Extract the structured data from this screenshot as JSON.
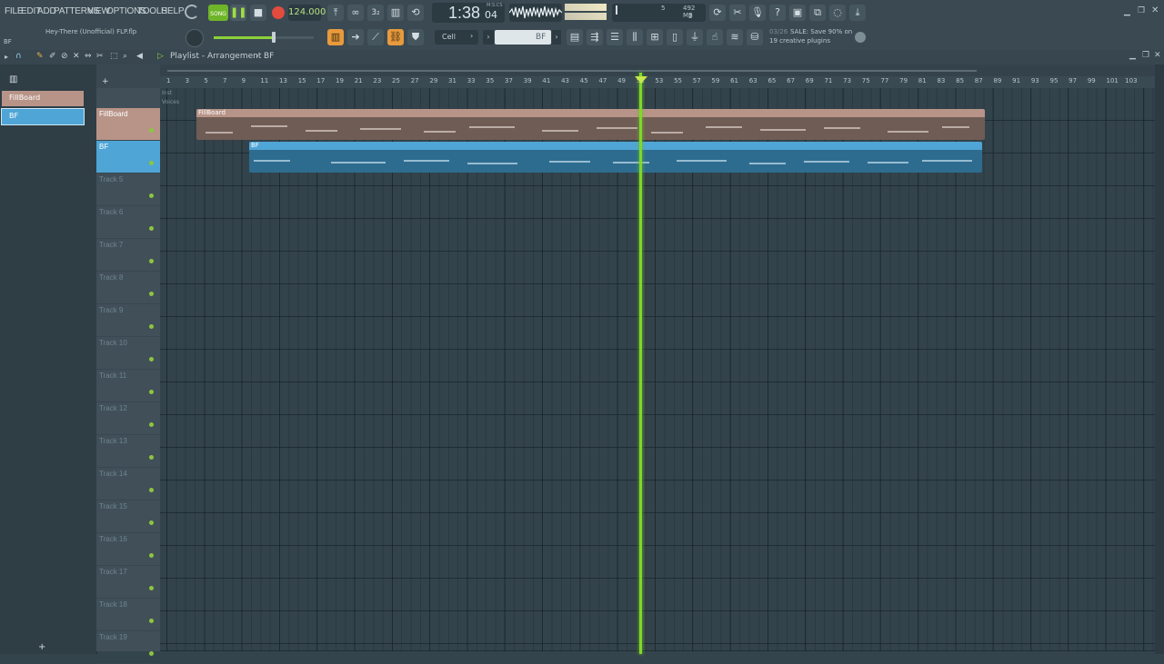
{
  "menu": [
    "FILE",
    "EDIT",
    "ADD",
    "PATTERNS",
    "VIEW",
    "OPTIONS",
    "TOOLS",
    "HELP"
  ],
  "transport": {
    "song_label": "SONG",
    "tempo": "124.000",
    "time": "1:38",
    "time_sub": "04",
    "time_unit": "M:S:CS",
    "memory": "492 MB",
    "cpu_voices": "5",
    "cpu_second": "2"
  },
  "project": {
    "title": "Hey-There (Unofficial) FLP.flp",
    "pattern_hint": "BF"
  },
  "snap": {
    "value": "Cell"
  },
  "pattern_selector": {
    "value": "BF"
  },
  "news": {
    "date": "03/26",
    "line1": "SALE: Save 90% on",
    "line2": "19 creative plugins"
  },
  "playlist": {
    "title": "Playlist - Arrangement",
    "breadcrumb": "BF"
  },
  "pattern_list": [
    {
      "name": "FillBoard",
      "color": "#b89488"
    },
    {
      "name": "BF",
      "color": "#4fa5d6"
    }
  ],
  "ruler_ticks": [
    "1",
    "3",
    "5",
    "7",
    "9",
    "11",
    "13",
    "15",
    "17",
    "19",
    "21",
    "23",
    "25",
    "27",
    "29",
    "31",
    "33",
    "35",
    "37",
    "39",
    "41",
    "43",
    "45",
    "47",
    "49",
    "51",
    "53",
    "55",
    "57",
    "59",
    "61",
    "63",
    "65",
    "67",
    "69",
    "71",
    "73",
    "75",
    "77",
    "79",
    "81",
    "83",
    "85",
    "87",
    "89",
    "91",
    "93",
    "95",
    "97",
    "99",
    "101",
    "103"
  ],
  "mini_tracks": [
    "Inst",
    "Voices"
  ],
  "tracks": [
    {
      "name": "FillBoard",
      "color": "#b89488"
    },
    {
      "name": "BF",
      "color": "#4fa5d6"
    },
    {
      "name": "Track 5"
    },
    {
      "name": "Track 6"
    },
    {
      "name": "Track 7"
    },
    {
      "name": "Track 8"
    },
    {
      "name": "Track 9"
    },
    {
      "name": "Track 10"
    },
    {
      "name": "Track 11"
    },
    {
      "name": "Track 12"
    },
    {
      "name": "Track 13"
    },
    {
      "name": "Track 14"
    },
    {
      "name": "Track 15"
    },
    {
      "name": "Track 16"
    },
    {
      "name": "Track 17"
    },
    {
      "name": "Track 18"
    },
    {
      "name": "Track 19"
    }
  ],
  "clips": [
    {
      "name": "FillBoard",
      "color": "#b89488",
      "body": "#6f5c55"
    },
    {
      "name": "BF",
      "color": "#4fa5d6",
      "body": "#2e6c8f"
    }
  ],
  "colors": {
    "playhead": "#7fd82a",
    "accent": "#e89a3c",
    "record": "#e24b3d"
  }
}
